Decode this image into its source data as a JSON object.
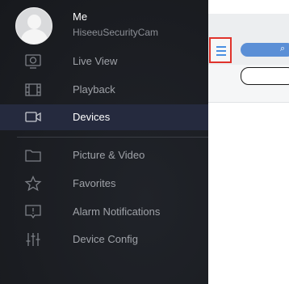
{
  "user": {
    "name": "Me",
    "subtitle": "HiseeuSecurityCam"
  },
  "menu": [
    {
      "label": "Live View",
      "icon": "live-view-icon",
      "active": false
    },
    {
      "label": "Playback",
      "icon": "playback-film-icon",
      "active": false
    },
    {
      "label": "Devices",
      "icon": "camera-device-icon",
      "active": true
    },
    {
      "label": "Picture & Video",
      "icon": "folder-icon",
      "active": false
    },
    {
      "label": "Favorites",
      "icon": "star-icon",
      "active": false
    },
    {
      "label": "Alarm Notifications",
      "icon": "alarm-message-icon",
      "active": false
    },
    {
      "label": "Device Config",
      "icon": "sliders-icon",
      "active": false
    }
  ],
  "colors": {
    "drawer_bg": "#1b1d22",
    "active_bg": "#252a3e",
    "highlight": "#e0332c",
    "accent": "#5b8fd6"
  }
}
